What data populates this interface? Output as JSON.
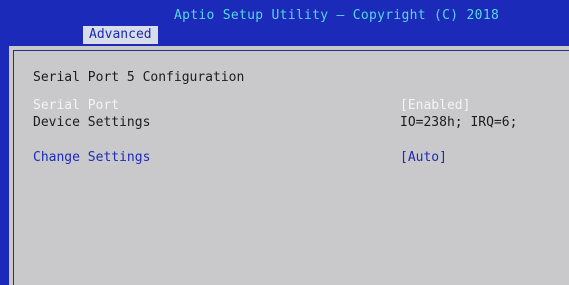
{
  "header": {
    "title": "Aptio Setup Utility – Copyright (C) 2018",
    "active_tab": "Advanced"
  },
  "page": {
    "heading": "Serial Port 5 Configuration",
    "items": [
      {
        "label": "Serial Port",
        "value": "[Enabled]"
      },
      {
        "label": "Device Settings",
        "value": "IO=238h; IRQ=6;"
      },
      {
        "label": "Change Settings",
        "value": "[Auto]"
      }
    ]
  },
  "colors": {
    "header_bg": "#1b2ab8",
    "title_text": "#56d7e6",
    "panel_bg": "#c9c9cc",
    "selected_text": "#f4f4f4",
    "option_text": "#1b2ab8",
    "static_text": "#1c1c1c"
  }
}
